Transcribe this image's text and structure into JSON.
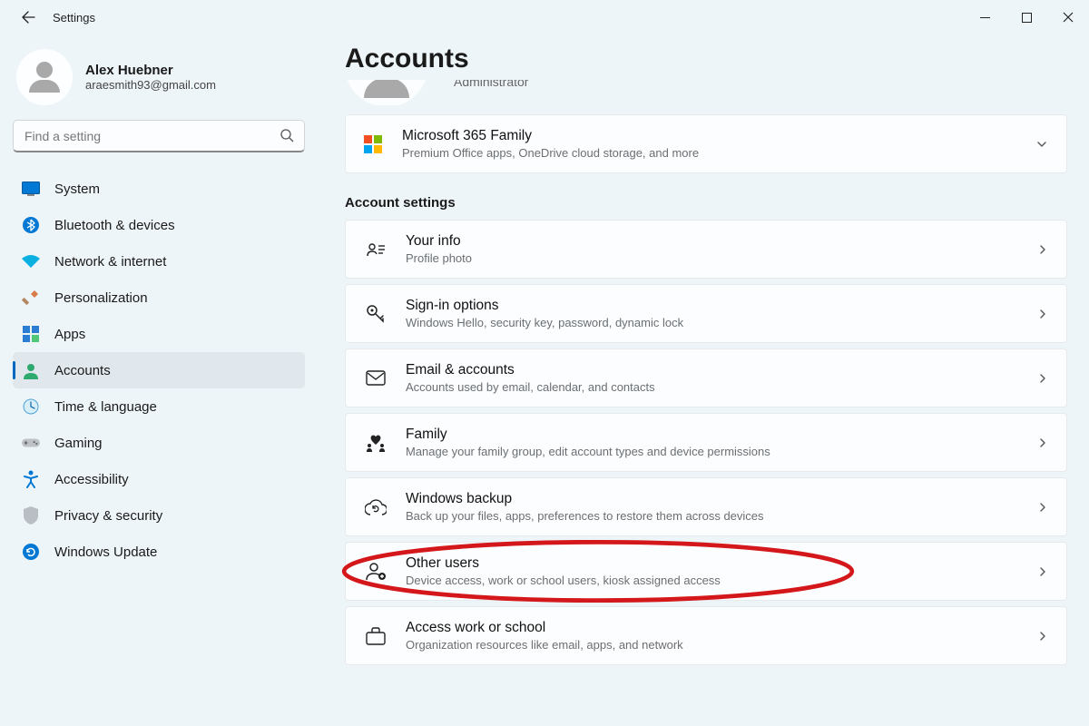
{
  "window": {
    "title": "Settings"
  },
  "profile": {
    "name": "Alex Huebner",
    "email": "araesmith93@gmail.com"
  },
  "search": {
    "placeholder": "Find a setting"
  },
  "nav": [
    {
      "label": "System",
      "icon": "system"
    },
    {
      "label": "Bluetooth & devices",
      "icon": "bluetooth"
    },
    {
      "label": "Network & internet",
      "icon": "network"
    },
    {
      "label": "Personalization",
      "icon": "personalization"
    },
    {
      "label": "Apps",
      "icon": "apps"
    },
    {
      "label": "Accounts",
      "icon": "accounts",
      "active": true
    },
    {
      "label": "Time & language",
      "icon": "time"
    },
    {
      "label": "Gaming",
      "icon": "gaming"
    },
    {
      "label": "Accessibility",
      "icon": "accessibility"
    },
    {
      "label": "Privacy & security",
      "icon": "privacy"
    },
    {
      "label": "Windows Update",
      "icon": "update"
    }
  ],
  "page": {
    "title": "Accounts",
    "cutoff_label": "Administrator",
    "ms365": {
      "title": "Microsoft 365 Family",
      "sub": "Premium Office apps, OneDrive cloud storage, and more"
    },
    "section_label": "Account settings",
    "rows": [
      {
        "title": "Your info",
        "sub": "Profile photo",
        "icon": "yourinfo"
      },
      {
        "title": "Sign-in options",
        "sub": "Windows Hello, security key, password, dynamic lock",
        "icon": "key"
      },
      {
        "title": "Email & accounts",
        "sub": "Accounts used by email, calendar, and contacts",
        "icon": "mail"
      },
      {
        "title": "Family",
        "sub": "Manage your family group, edit account types and device permissions",
        "icon": "family"
      },
      {
        "title": "Windows backup",
        "sub": "Back up your files, apps, preferences to restore them across devices",
        "icon": "backup"
      },
      {
        "title": "Other users",
        "sub": "Device access, work or school users, kiosk assigned access",
        "icon": "otherusers",
        "highlighted": true
      },
      {
        "title": "Access work or school",
        "sub": "Organization resources like email, apps, and network",
        "icon": "work"
      }
    ]
  }
}
